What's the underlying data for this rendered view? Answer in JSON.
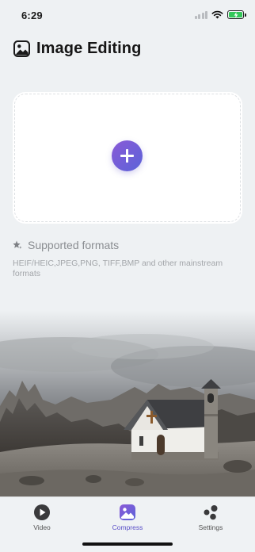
{
  "status_bar": {
    "time": "6:29"
  },
  "header": {
    "title": "Image Editing",
    "icon": "image-icon"
  },
  "upload": {
    "add_icon": "plus-icon",
    "accent_start": "#8a5ad7",
    "accent_end": "#5b63d8"
  },
  "formats": {
    "icon": "sparkle-star-icon",
    "title": "Supported formats",
    "description": "HEIF/HEIC,JPEG,PNG, TIFF,BMP and other mainstream formats"
  },
  "tabs": [
    {
      "label": "Video",
      "icon": "play-circle-icon",
      "active": false
    },
    {
      "label": "Compress",
      "icon": "photo-icon",
      "active": true
    },
    {
      "label": "Settings",
      "icon": "dots-cluster-icon",
      "active": false
    }
  ]
}
